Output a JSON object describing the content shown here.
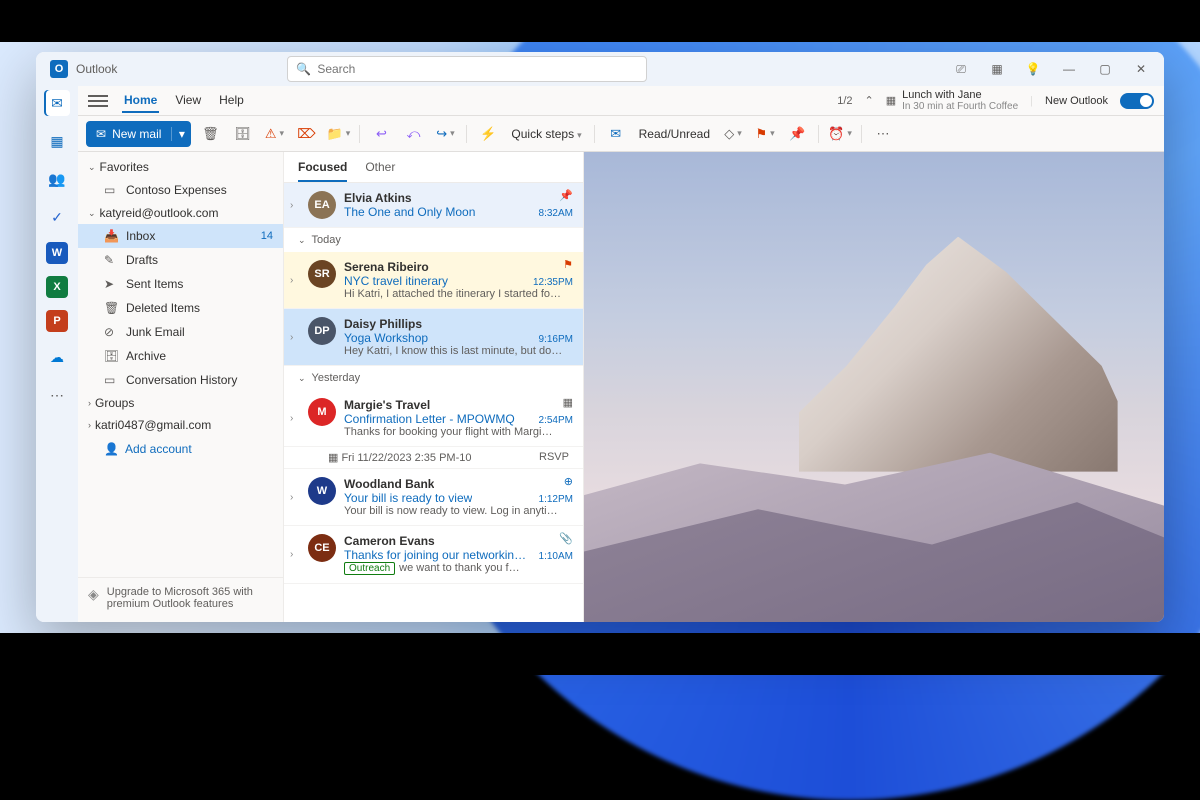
{
  "app": {
    "name": "Outlook"
  },
  "search": {
    "placeholder": "Search"
  },
  "titlebar_icons": [
    "meet-now-icon",
    "calendar-day-icon",
    "lightbulb-icon"
  ],
  "window_controls": [
    "minimize",
    "maximize",
    "close"
  ],
  "tabs": {
    "items": [
      "Home",
      "View",
      "Help"
    ],
    "active": 0
  },
  "counter": "1/2",
  "calendar_peek": {
    "title": "Lunch with Jane",
    "subtitle": "In 30 min at Fourth Coffee"
  },
  "new_outlook": {
    "label": "New Outlook",
    "on": true
  },
  "ribbon": {
    "new_mail": "New mail",
    "quick_steps": "Quick steps",
    "read_unread": "Read/Unread"
  },
  "app_rail": [
    {
      "name": "mail",
      "color": "#0f6cbd",
      "glyph": "✉",
      "active": true
    },
    {
      "name": "calendar",
      "color": "#0f6cbd",
      "glyph": "▦"
    },
    {
      "name": "people",
      "color": "#605e5c",
      "glyph": "👥"
    },
    {
      "name": "todo",
      "color": "#2564cf",
      "glyph": "✓"
    },
    {
      "name": "word",
      "color": "#185abd",
      "glyph": "W"
    },
    {
      "name": "excel",
      "color": "#107c41",
      "glyph": "X"
    },
    {
      "name": "powerpoint",
      "color": "#c43e1c",
      "glyph": "P"
    },
    {
      "name": "onedrive",
      "color": "#0078d4",
      "glyph": "☁"
    },
    {
      "name": "more",
      "color": "#605e5c",
      "glyph": "⋯"
    }
  ],
  "nav": {
    "favorites": {
      "label": "Favorites",
      "items": [
        {
          "label": "Contoso Expenses",
          "icon": "▭"
        }
      ]
    },
    "accounts": [
      {
        "label": "katyreid@outlook.com",
        "folders": [
          {
            "label": "Inbox",
            "icon": "📥",
            "count": 14,
            "selected": true
          },
          {
            "label": "Drafts",
            "icon": "✎"
          },
          {
            "label": "Sent Items",
            "icon": "➤"
          },
          {
            "label": "Deleted Items",
            "icon": "🗑"
          },
          {
            "label": "Junk Email",
            "icon": "⊘"
          },
          {
            "label": "Archive",
            "icon": "🗄"
          },
          {
            "label": "Conversation History",
            "icon": "▭"
          }
        ]
      }
    ],
    "groups": {
      "label": "Groups"
    },
    "account2": "katri0487@gmail.com",
    "add_account": "Add account",
    "upsell": "Upgrade to Microsoft 365 with premium Outlook features"
  },
  "msglist": {
    "tabs": [
      "Focused",
      "Other"
    ],
    "active_tab": 0,
    "sections": [
      {
        "pinned": true,
        "messages": [
          {
            "from": "Elvia Atkins",
            "subject": "The One and Only Moon",
            "time": "8:32AM",
            "avatar": "#8b7355",
            "initials": "EA",
            "pin": true
          }
        ]
      },
      {
        "label": "Today",
        "messages": [
          {
            "from": "Serena Ribeiro",
            "subject": "NYC travel itinerary",
            "preview": "Hi Katri, I attached the itinerary I started fo…",
            "time": "12:35PM",
            "avatar": "#6b4423",
            "initials": "SR",
            "flagged": true,
            "flag_icon": "⚑"
          },
          {
            "from": "Daisy Phillips",
            "subject": "Yoga Workshop",
            "preview": "Hey Katri, I know this is last minute, but do…",
            "time": "9:16PM",
            "avatar": "#4a5568",
            "initials": "DP",
            "selected": true
          }
        ]
      },
      {
        "label": "Yesterday",
        "messages": [
          {
            "from": "Margie's Travel",
            "subject": "Confirmation Letter - MPOWMQ",
            "preview": "Thanks for booking your flight with Margi…",
            "time": "2:54PM",
            "avatar": "#dc2626",
            "initials": "M",
            "meeting": {
              "when": "Fri 11/22/2023 2:35 PM-10",
              "rsvp": "RSVP"
            },
            "cal_icon": true
          },
          {
            "from": "Woodland Bank",
            "subject": "Your bill is ready to view",
            "preview": "Your bill is now ready to view. Log in anyti…",
            "time": "1:12PM",
            "avatar": "#1e3a8a",
            "initials": "W",
            "ext_icon": true
          },
          {
            "from": "Cameron Evans",
            "subject": "Thanks for joining our networking…",
            "preview": "we want to thank you f…",
            "time": "1:10AM",
            "avatar": "#7c2d12",
            "initials": "CE",
            "tag": "Outreach",
            "attach": true
          }
        ]
      }
    ]
  }
}
